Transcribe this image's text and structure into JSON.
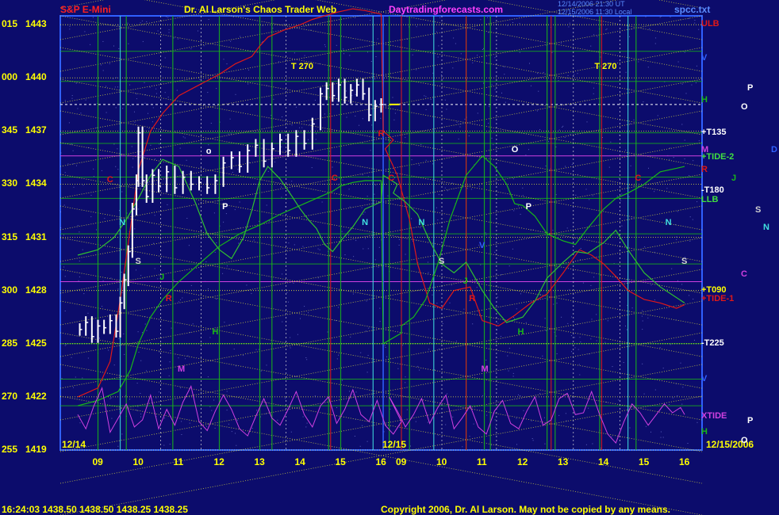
{
  "header": {
    "symbol": "S&P E-Mini",
    "title": "Dr. Al Larson's Chaos Trader Web",
    "site": "Daytradingforecasts.com",
    "stamp1": "12/14/2006 21:30 UT",
    "stamp2": "12/15/2006 11:30 Local",
    "source": "spcc.txt"
  },
  "footer": {
    "quote": "16:24:03  1438.50  1438.50  1438.25  1438.25",
    "copyright": "Copyright 2006, Dr. Al Larson. May not be copied by any means."
  },
  "colors": {
    "background": "#0c0c6c",
    "price": "#ffffff",
    "grid_yellow": "#e6e63c",
    "tide_red": "#e01818",
    "tide_green": "#18b818",
    "xtide_magenta": "#d040e0",
    "time_cyan": "#40e0e0"
  },
  "chart_data": {
    "type": "line",
    "title": "S&P E-Mini",
    "y_ticks": [
      {
        "value": 1443,
        "left": "015",
        "right": "1443"
      },
      {
        "value": 1440,
        "left": "000",
        "right": "1440"
      },
      {
        "value": 1437,
        "left": "345",
        "right": "1437"
      },
      {
        "value": 1434,
        "left": "330",
        "right": "1434"
      },
      {
        "value": 1431,
        "left": "315",
        "right": "1431"
      },
      {
        "value": 1428,
        "left": "300",
        "right": "1428"
      },
      {
        "value": 1425,
        "left": "285",
        "right": "1425"
      },
      {
        "value": 1422,
        "left": "270",
        "right": "1422"
      },
      {
        "value": 1419,
        "left": "255",
        "right": "1419"
      }
    ],
    "ylim": [
      1419,
      1443.5
    ],
    "xlim": [
      8.5,
      16.25
    ],
    "x_ticks_day1": [
      "09",
      "10",
      "11",
      "12",
      "13",
      "14",
      "15",
      "16"
    ],
    "x_ticks_day2": [
      "09",
      "10",
      "11",
      "12",
      "13",
      "14",
      "15",
      "16"
    ],
    "date_labels": [
      "12/14",
      "12/15",
      "12/15/2006"
    ],
    "price": {
      "day": "12/14",
      "x": [
        8.55,
        8.7,
        8.85,
        9.0,
        9.15,
        9.3,
        9.45,
        9.55,
        9.65,
        9.75,
        9.85,
        9.95,
        10.0,
        10.1,
        10.2,
        10.35,
        10.5,
        10.7,
        10.9,
        11.1,
        11.3,
        11.5,
        11.7,
        11.9,
        12.1,
        12.3,
        12.5,
        12.7,
        12.9,
        13.1,
        13.3,
        13.5,
        13.7,
        13.9,
        14.1,
        14.3,
        14.5,
        14.65,
        14.8,
        14.95,
        15.1,
        15.25,
        15.4,
        15.55,
        15.7,
        15.85,
        16.0
      ],
      "y": [
        1425.8,
        1426.2,
        1425.4,
        1426.0,
        1425.9,
        1426.3,
        1425.7,
        1427.3,
        1428.6,
        1430.2,
        1432.6,
        1434.2,
        1436.9,
        1434.2,
        1433.3,
        1434.5,
        1433.9,
        1434.7,
        1433.8,
        1434.4,
        1434.0,
        1434.1,
        1433.8,
        1434.2,
        1435.2,
        1435.5,
        1435.0,
        1435.9,
        1436.2,
        1435.3,
        1436.0,
        1436.5,
        1435.9,
        1436.7,
        1436.3,
        1437.4,
        1439.1,
        1439.4,
        1439.0,
        1439.6,
        1438.9,
        1439.3,
        1439.6,
        1439.1,
        1437.9,
        1438.4,
        1438.5
      ]
    },
    "series": [
      {
        "name": "+TIDE-1",
        "x": [
          8.5,
          9.0,
          9.3,
          9.55,
          9.8,
          10.0,
          10.3,
          10.6,
          11.0,
          11.5,
          12.0,
          12.4,
          12.8,
          13.0,
          13.2,
          13.6,
          14.0,
          14.3,
          14.6,
          14.9,
          15.1,
          15.3,
          15.6,
          16.0,
          16.05,
          16.3,
          16.6,
          16.9,
          17.2,
          17.4,
          17.7,
          18.0,
          18.3,
          18.7,
          19.0,
          19.4,
          19.8,
          20.2,
          20.6,
          21.0,
          21.4,
          21.7,
          22.0,
          22.3,
          22.6,
          23.0,
          23.4,
          23.8,
          24.0
        ],
        "y": [
          1422.0,
          1422.5,
          1424.0,
          1427.5,
          1431.5,
          1434.8,
          1437.0,
          1438.0,
          1439.0,
          1439.6,
          1440.2,
          1440.8,
          1441.2,
          1441.8,
          1442.3,
          1442.7,
          1443.0,
          1443.3,
          1443.5,
          1443.7,
          1443.8,
          1443.9,
          1443.8,
          1443.6,
          1437.0,
          1436.5,
          1436.0,
          1434.5,
          1432.0,
          1429.5,
          1427.3,
          1427.0,
          1428.0,
          1428.2,
          1426.3,
          1426.0,
          1426.6,
          1427.3,
          1427.8,
          1429.0,
          1430.3,
          1430.0,
          1429.5,
          1428.8,
          1428.0,
          1427.5,
          1427.3,
          1427.0,
          1427.2
        ]
      },
      {
        "name": "+TIDE-2",
        "x": [
          8.5,
          9.0,
          9.5,
          9.8,
          10.0,
          10.3,
          10.6,
          11.0,
          11.5,
          12.0,
          12.5,
          13.0,
          13.5,
          14.0,
          14.5,
          14.8,
          15.0,
          15.3,
          15.6,
          16.0,
          16.05,
          16.5,
          17.0,
          17.3,
          17.6,
          17.9,
          18.2,
          18.6,
          19.0,
          19.3,
          19.6,
          19.8,
          20.0,
          20.3,
          20.6,
          21.0,
          21.3,
          21.6,
          22.0,
          22.3,
          22.6,
          23.0,
          23.4,
          23.8,
          24.0
        ],
        "y": [
          1421.5,
          1421.8,
          1422.3,
          1423.5,
          1425.0,
          1426.5,
          1427.5,
          1428.5,
          1429.5,
          1430.5,
          1431.2,
          1431.7,
          1432.3,
          1432.8,
          1433.3,
          1433.6,
          1433.9,
          1434.1,
          1434.2,
          1434.2,
          1425.0,
          1425.6,
          1426.0,
          1426.5,
          1427.5,
          1429.5,
          1432.0,
          1434.5,
          1435.6,
          1435.0,
          1434.0,
          1432.9,
          1432.8,
          1432.2,
          1431.2,
          1430.8,
          1430.6,
          1431.5,
          1432.6,
          1433.2,
          1433.5,
          1434.0,
          1434.7,
          1434.9,
          1435.0
        ]
      },
      {
        "name": "LLB",
        "x": [
          8.5,
          9.0,
          9.4,
          9.7,
          10.0,
          10.3,
          10.6,
          11.0,
          11.4,
          11.7,
          12.0,
          12.3,
          12.6,
          12.8,
          13.0,
          13.2,
          13.5,
          13.8,
          14.0,
          14.2,
          14.4,
          14.6,
          14.8,
          15.0,
          15.3,
          15.6,
          16.0,
          16.05,
          16.4,
          16.8,
          17.1,
          17.4,
          17.7,
          18.0,
          18.3,
          18.6,
          19.0,
          19.3,
          19.6,
          20.0,
          20.3,
          20.6,
          21.0,
          21.3,
          21.6,
          22.0,
          22.3,
          22.6,
          23.0,
          23.4,
          23.8,
          24.0
        ],
        "y": [
          1430.0,
          1430.3,
          1431.0,
          1432.0,
          1433.2,
          1434.5,
          1435.4,
          1435.0,
          1433.0,
          1431.2,
          1430.3,
          1429.8,
          1431.0,
          1432.5,
          1434.2,
          1435.0,
          1434.3,
          1433.3,
          1432.6,
          1432.0,
          1431.5,
          1430.6,
          1430.2,
          1430.8,
          1431.6,
          1432.6,
          1433.0,
          1434.5,
          1434.0,
          1433.5,
          1433.0,
          1432.3,
          1430.8,
          1429.5,
          1429.0,
          1429.6,
          1428.0,
          1427.0,
          1426.2,
          1426.5,
          1427.4,
          1428.7,
          1429.6,
          1430.2,
          1430.1,
          1430.7,
          1431.4,
          1430.3,
          1429.0,
          1428.2,
          1427.6,
          1427.3
        ]
      }
    ],
    "xtide": {
      "name": "XTIDE",
      "x": [
        8.5,
        8.7,
        8.9,
        9.1,
        9.3,
        9.5,
        9.7,
        9.9,
        10.1,
        10.3,
        10.5,
        10.7,
        10.9,
        11.1,
        11.3,
        11.5,
        11.7,
        11.9,
        12.1,
        12.3,
        12.5,
        12.7,
        12.9,
        13.1,
        13.3,
        13.5,
        13.7,
        13.9,
        14.1,
        14.3,
        14.5,
        14.7,
        14.9,
        15.1,
        15.3,
        15.5,
        15.7,
        15.9,
        16.1,
        16.3,
        16.5,
        16.7,
        16.9,
        17.1,
        17.3,
        17.5,
        17.7,
        17.9,
        18.1,
        18.3,
        18.5,
        18.7,
        18.9,
        19.1,
        19.3,
        19.5,
        19.7,
        19.9,
        20.1,
        20.3,
        20.5,
        20.7,
        20.9,
        21.1,
        21.3,
        21.5,
        21.7,
        21.9,
        22.1,
        22.3,
        22.5,
        22.7,
        22.9,
        23.1,
        23.3,
        23.5,
        23.7,
        23.9,
        24.0
      ],
      "y": [
        1421.0,
        1420.2,
        1421.5,
        1422.5,
        1420.0,
        1420.8,
        1421.6,
        1420.3,
        1420.7,
        1422.1,
        1420.2,
        1421.3,
        1420.4,
        1421.7,
        1422.6,
        1420.6,
        1420.1,
        1421.2,
        1422.1,
        1421.3,
        1420.2,
        1419.8,
        1420.9,
        1421.9,
        1420.8,
        1420.4,
        1421.3,
        1422.3,
        1421.0,
        1420.3,
        1421.5,
        1422.0,
        1420.5,
        1421.3,
        1422.4,
        1421.0,
        1420.6,
        1421.8,
        1420.4,
        1419.9,
        1420.6,
        1422.0,
        1421.2,
        1420.3,
        1421.0,
        1421.9,
        1420.5,
        1421.4,
        1422.1,
        1420.2,
        1420.8,
        1421.5,
        1420.3,
        1419.9,
        1421.2,
        1421.8,
        1420.5,
        1420.2,
        1421.2,
        1422.0,
        1420.4,
        1420.7,
        1421.9,
        1422.2,
        1421.0,
        1421.1,
        1422.3,
        1421.0,
        1419.9,
        1419.4,
        1420.6,
        1421.6,
        1421.1,
        1420.4,
        1421.0,
        1421.6,
        1421.1,
        1421.4,
        1421.0
      ]
    },
    "time_lines": {
      "cyan": [
        9.55,
        15.8,
        17.8,
        22.6
      ],
      "green": [
        9.0,
        9.7,
        10.85,
        12.0,
        13.0,
        13.3,
        14.7,
        15.0,
        16.7,
        17.2,
        18.6,
        19.05,
        19.2,
        20.6,
        20.8,
        21.9,
        22.8
      ],
      "red": [
        14.75,
        17.0,
        18.6,
        20.7,
        21.95
      ],
      "white": [
        10.55,
        11.55,
        13.65,
        16.05,
        18.0,
        19.35,
        21.25,
        22.4
      ]
    },
    "price_lines": {
      "green": [
        1441.5,
        1439.8,
        1436.9,
        1436.3,
        1434.4,
        1433.2,
        1431.2,
        1429.5,
        1425.0,
        1423.0,
        1421.5
      ],
      "white": [
        1438.5
      ],
      "magenta": [
        1435.6,
        1428.5
      ]
    },
    "planet_markers": [
      {
        "label": "C",
        "x": 9.3,
        "y": 1434.2,
        "color": "#e01818"
      },
      {
        "label": "N",
        "x": 9.6,
        "y": 1431.8,
        "color": "#40e0e0"
      },
      {
        "label": "S",
        "x": 10.0,
        "y": 1429.6,
        "color": "#d0d0d0"
      },
      {
        "label": "J",
        "x": 10.6,
        "y": 1428.7,
        "color": "#18b818"
      },
      {
        "label": "R",
        "x": 10.75,
        "y": 1427.5,
        "color": "#e01818"
      },
      {
        "label": "M",
        "x": 11.05,
        "y": 1423.5,
        "color": "#d040e0"
      },
      {
        "label": "H",
        "x": 11.9,
        "y": 1425.6,
        "color": "#18b818"
      },
      {
        "label": "o",
        "x": 11.75,
        "y": 1435.8,
        "color": "#ffffff"
      },
      {
        "label": "P",
        "x": 12.15,
        "y": 1432.7,
        "color": "#ffffff"
      },
      {
        "label": "T 270",
        "x": 13.85,
        "y": 1440.6,
        "color": "#ffff00"
      },
      {
        "label": "C",
        "x": 14.85,
        "y": 1434.3,
        "color": "#e01818"
      },
      {
        "label": "N",
        "x": 15.6,
        "y": 1431.8,
        "color": "#40e0e0"
      },
      {
        "label": "R",
        "x": 16.0,
        "y": 1436.8,
        "color": "#e01818"
      },
      {
        "label": "C",
        "x": 16.75,
        "y": 1434.3,
        "color": "#e01818"
      },
      {
        "label": "N",
        "x": 17.5,
        "y": 1431.8,
        "color": "#40e0e0"
      },
      {
        "label": "S",
        "x": 18.0,
        "y": 1429.6,
        "color": "#d0d0d0"
      },
      {
        "label": "J",
        "x": 18.6,
        "y": 1428.5,
        "color": "#18b818"
      },
      {
        "label": "R",
        "x": 18.75,
        "y": 1427.5,
        "color": "#e01818"
      },
      {
        "label": "V",
        "x": 19.0,
        "y": 1430.5,
        "color": "#3060ff"
      },
      {
        "label": "M",
        "x": 19.05,
        "y": 1423.5,
        "color": "#d040e0"
      },
      {
        "label": "O",
        "x": 19.8,
        "y": 1435.9,
        "color": "#ffffff"
      },
      {
        "label": "H",
        "x": 19.95,
        "y": 1425.6,
        "color": "#18b818"
      },
      {
        "label": "P",
        "x": 20.15,
        "y": 1432.7,
        "color": "#ffffff"
      },
      {
        "label": "T 270",
        "x": 21.85,
        "y": 1440.6,
        "color": "#ffff00"
      },
      {
        "label": "C",
        "x": 22.85,
        "y": 1434.3,
        "color": "#e01818"
      },
      {
        "label": "N",
        "x": 23.6,
        "y": 1431.8,
        "color": "#40e0e0"
      },
      {
        "label": "S",
        "x": 24.0,
        "y": 1429.6,
        "color": "#d0d0d0"
      }
    ],
    "right_labels": [
      {
        "label": "ULB",
        "y": 1443.0,
        "color": "#e01818"
      },
      {
        "label": "V",
        "y": 1441.1,
        "color": "#3060ff"
      },
      {
        "label": "H",
        "y": 1438.7,
        "color": "#18b818"
      },
      {
        "label": "+T135",
        "y": 1436.9,
        "color": "#ffffff"
      },
      {
        "label": "M",
        "y": 1435.9,
        "color": "#d040e0"
      },
      {
        "label": "+TIDE-2",
        "y": 1435.5,
        "color": "#40e040"
      },
      {
        "label": "R",
        "y": 1434.8,
        "color": "#e01818"
      },
      {
        "label": "-T180",
        "y": 1433.6,
        "color": "#ffffff"
      },
      {
        "label": "LLB",
        "y": 1433.1,
        "color": "#40e040"
      },
      {
        "label": "+T090",
        "y": 1428.0,
        "color": "#ffff00"
      },
      {
        "label": "+TIDE-1",
        "y": 1427.5,
        "color": "#e01818"
      },
      {
        "label": "-T225",
        "y": 1425.0,
        "color": "#ffffff"
      },
      {
        "label": "V",
        "y": 1423.0,
        "color": "#3060ff"
      },
      {
        "label": "XTIDE",
        "y": 1420.9,
        "color": "#d040e0"
      },
      {
        "label": "H",
        "y": 1420.0,
        "color": "#18b818"
      }
    ],
    "far_right_labels": [
      {
        "label": "P",
        "x": 942,
        "y": 1439.4,
        "color": "#ffffff"
      },
      {
        "label": "O",
        "x": 934,
        "y": 1438.3,
        "color": "#ffffff"
      },
      {
        "label": "D",
        "x": 972,
        "y": 1435.9,
        "color": "#3060ff"
      },
      {
        "label": "J",
        "x": 922,
        "y": 1434.3,
        "color": "#18b818"
      },
      {
        "label": "S",
        "x": 952,
        "y": 1432.5,
        "color": "#d0d0d0"
      },
      {
        "label": "N",
        "x": 962,
        "y": 1431.5,
        "color": "#40e0e0"
      },
      {
        "label": "C",
        "x": 934,
        "y": 1428.9,
        "color": "#d040e0"
      },
      {
        "label": "P",
        "x": 942,
        "y": 1420.6,
        "color": "#ffffff"
      },
      {
        "label": "O",
        "x": 934,
        "y": 1419.5,
        "color": "#ffffff"
      }
    ]
  }
}
